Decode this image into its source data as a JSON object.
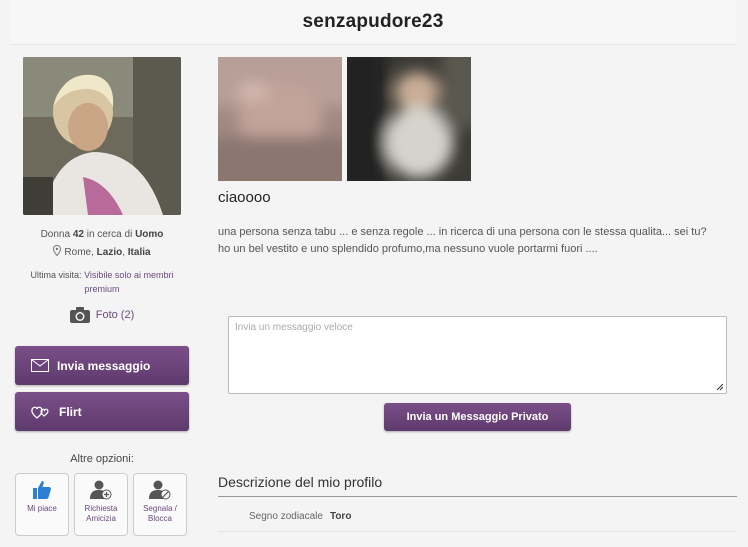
{
  "header": {
    "username": "senzapudore23"
  },
  "profile": {
    "gender": "Donna",
    "age": "42",
    "seeking_text": "in cerca di",
    "seeking": "Uomo",
    "city": "Rome",
    "region": "Lazio",
    "country": "Italia",
    "last_visit_label": "Ultima visita:",
    "last_visit_value": "Visibile solo ai membri premium",
    "photos_label": "Foto (2)"
  },
  "actions": {
    "send_message": "Invia messaggio",
    "flirt": "Flirt",
    "more_options": "Altre opzioni:",
    "like": "Mi piace",
    "friend_request": "Richiesta Amicizia",
    "report_block": "Segnala / Blocca"
  },
  "main": {
    "status": "ciaoooo",
    "bio": "una persona senza tabu ... e senza regole ... in ricerca di una persona con le stessa qualita... sei tu?ho un bel vestito e uno splendido profumo,ma nessuno vuole portarmi fuori ....",
    "message_placeholder": "Invia un messaggio veloce",
    "private_message_button": "Invia un Messaggio Privato",
    "description_title": "Descrizione del mio profilo",
    "zodiac_label": "Segno zodiacale",
    "zodiac_value": "Toro"
  },
  "colors": {
    "accent": "#6b4a7f",
    "button": "#5e3a6d",
    "like_icon": "#2a7fd4"
  }
}
